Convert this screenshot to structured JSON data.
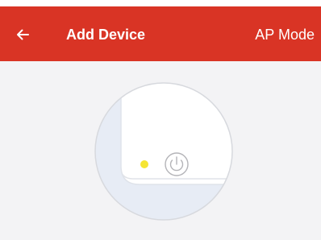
{
  "header": {
    "title": "Add Device",
    "mode_link": "AP Mode"
  },
  "colors": {
    "app_bar": "#d93425",
    "background": "#f3f3f5",
    "indicator_light": "#f5e534"
  },
  "icons": {
    "back": "arrow-left-icon",
    "power": "power-icon",
    "indicator": "indicator-light"
  }
}
